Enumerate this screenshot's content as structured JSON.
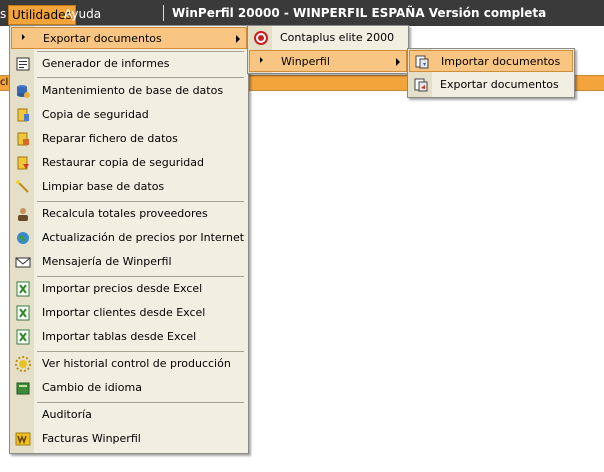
{
  "menubar": {
    "prev_fragment": "s",
    "utilidades": "Utilidades",
    "ayuda": "Ayuda",
    "title": "WinPerfil 20000 - WINPERFIL ESPAÑA Versión completa"
  },
  "background": {
    "strip_fragment": "cl"
  },
  "utilidades_menu": {
    "items": [
      {
        "label": "Exportar documentos",
        "icon": "bullet-arrow-icon",
        "has_submenu": true
      },
      {
        "label": "Generador de informes",
        "icon": "report-icon"
      },
      {
        "label": "Mantenimiento de base de datos",
        "icon": "database-maintenance-icon"
      },
      {
        "label": "Copia de seguridad",
        "icon": "backup-icon"
      },
      {
        "label": "Reparar fichero de datos",
        "icon": "repair-icon"
      },
      {
        "label": "Restaurar copia de seguridad",
        "icon": "restore-icon"
      },
      {
        "label": "Limpiar base de datos",
        "icon": "clean-wand-icon"
      },
      {
        "label": "Recalcula totales proveedores",
        "icon": "supplier-user-icon"
      },
      {
        "label": "Actualización de precios por Internet",
        "icon": "globe-icon"
      },
      {
        "label": "Mensajería de Winperfil",
        "icon": "envelope-icon"
      },
      {
        "label": "Importar precios desde Excel",
        "icon": "excel-icon"
      },
      {
        "label": "Importar clientes desde Excel",
        "icon": "excel-icon"
      },
      {
        "label": "Importar tablas desde Excel",
        "icon": "excel-icon"
      },
      {
        "label": "Ver historial control de producción",
        "icon": "sun-gear-icon"
      },
      {
        "label": "Cambio de idioma",
        "icon": "book-icon"
      },
      {
        "label": "Auditoría",
        "icon": ""
      },
      {
        "label": "Facturas Winperfil",
        "icon": "winperfil-logo-icon"
      }
    ]
  },
  "exportar_submenu": {
    "items": [
      {
        "label": "Contaplus elite 2000",
        "icon": "contaplus-icon"
      },
      {
        "label": "Winperfil",
        "icon": "bullet-arrow-icon",
        "has_submenu": true
      }
    ]
  },
  "winperfil_submenu": {
    "items": [
      {
        "label": "Importar documentos",
        "icon": "import-docs-icon"
      },
      {
        "label": "Exportar documentos",
        "icon": "export-docs-icon"
      }
    ]
  },
  "colors": {
    "menubar_bg": "#3a3a3a",
    "highlight": "#f8c682",
    "menu_bg": "#f1efe2",
    "gutter": "#e3dfc9",
    "accent_orange": "#f3a43a"
  }
}
